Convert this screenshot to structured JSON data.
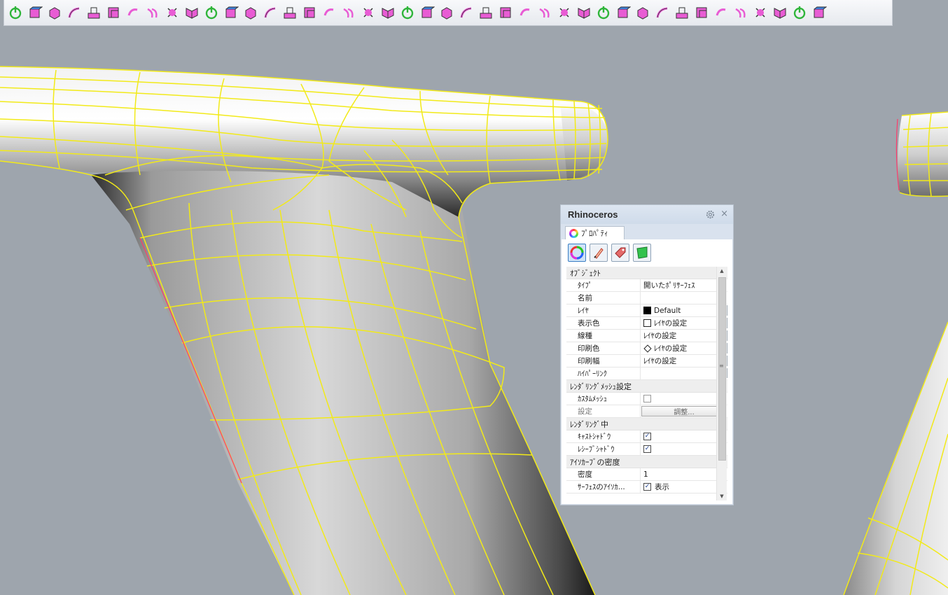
{
  "toolbar": {
    "icons": [
      "power-icon",
      "box-solid-icon",
      "cube-icon",
      "fillet-icon",
      "extrude-icon",
      "boolean-box-icon",
      "rotate-arrow-icon",
      "blend-icon",
      "transform-icon",
      "mirror-icon",
      "arch-icon",
      "twist-icon",
      "corner-icon",
      "cap-icon",
      "split-icon",
      "cube-edit-icon",
      "loft-icon",
      "sweep-icon",
      "checkbox-icon",
      "grid-icon",
      "layout-icon",
      "delete-points-icon",
      "sweep-rail-icon",
      "array-icon",
      "flip-icon",
      "cylinder-icon",
      "point-grid-icon",
      "rebuild-icon",
      "paint-icon",
      "scale-icon",
      "branch-icon",
      "diamond-icon",
      "snap-target-icon",
      "star-icon",
      "pentagon-icon",
      "flow-icon",
      "patch-icon",
      "network-icon",
      "mesh-icon",
      "explode-icon",
      "render-icon",
      "settings-icon"
    ]
  },
  "panel": {
    "title": "Rhinoceros",
    "tab_label": "ﾌﾟﾛﾊﾟﾃｨ",
    "sections": {
      "object": "ｵﾌﾞｼﾞｪｸﾄ",
      "render_mesh": "ﾚﾝﾀﾞﾘﾝｸﾞﾒｯｼｭ設定",
      "rendering": "ﾚﾝﾀﾞﾘﾝｸﾞ中",
      "isocurve": "ｱｲｿｶｰﾌﾞの密度"
    },
    "rows": {
      "type": {
        "key": "ﾀｲﾌﾟ",
        "value": "開いたﾎﾟﾘｻｰﾌｪｽ"
      },
      "name": {
        "key": "名前",
        "value": ""
      },
      "layer": {
        "key": "ﾚｲﾔ",
        "value": "Default"
      },
      "display_color": {
        "key": "表示色",
        "value": "ﾚｲﾔの設定"
      },
      "linetype": {
        "key": "線種",
        "value": "ﾚｲﾔの設定"
      },
      "print_color": {
        "key": "印刷色",
        "value": "ﾚｲﾔの設定"
      },
      "print_width": {
        "key": "印刷幅",
        "value": "ﾚｲﾔの設定"
      },
      "hyperlink": {
        "key": "ﾊｲﾊﾟｰﾘﾝｸ",
        "value": "",
        "button": "..."
      },
      "custom_mesh": {
        "key": "ｶｽﾀﾑﾒｯｼｭ",
        "checked": false
      },
      "settings": {
        "key": "設定",
        "button": "調整..."
      },
      "cast_shadow": {
        "key": "ｷｬｽﾄｼｬﾄﾞｳ",
        "checked": true
      },
      "receive_shadow": {
        "key": "ﾚｼｰﾌﾞｼｬﾄﾞｳ",
        "checked": true
      },
      "density": {
        "key": "密度",
        "value": "1"
      },
      "surface_iso": {
        "key": "ｻｰﾌｪｽのｱｲｿｶ...",
        "value": "表示",
        "checked": true
      }
    }
  },
  "colors": {
    "viewport_bg": "#9ea5ad",
    "isocurve": "#f2ea18",
    "panel_title_bg": "#d6e0ec"
  }
}
